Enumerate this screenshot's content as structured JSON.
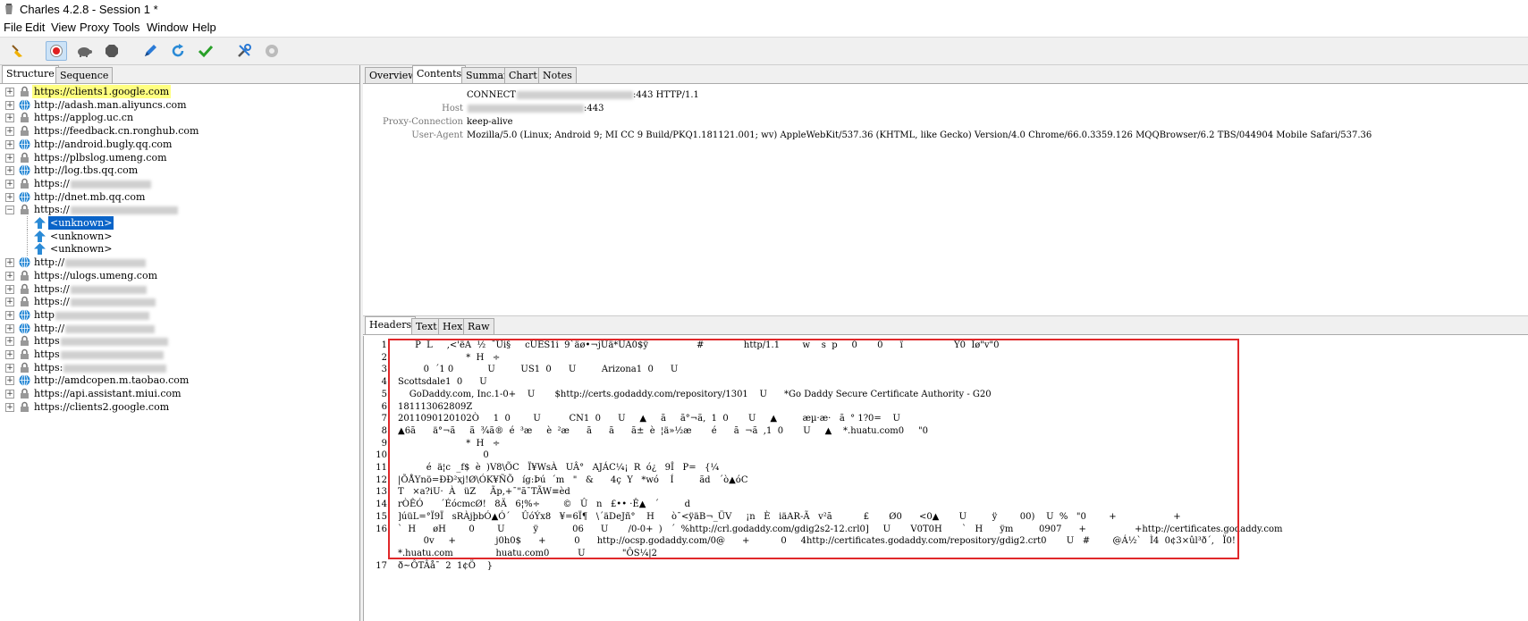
{
  "window": {
    "title": "Charles 4.2.8 - Session 1 *"
  },
  "menu": [
    "File",
    "Edit",
    "View",
    "Proxy",
    "Tools",
    "Window",
    "Help"
  ],
  "toolbar": {
    "icons": [
      "broom-icon",
      "record-icon",
      "turtle-icon",
      "hexagon-stop-icon",
      "pen-icon",
      "refresh-icon",
      "check-icon",
      "tools-icon",
      "gear-icon"
    ]
  },
  "left_tabs": [
    "Structure",
    "Sequence"
  ],
  "tree": [
    {
      "label": "https://clients1.google.com",
      "icon": "lock-icon",
      "state": "collapsed",
      "highlight": true
    },
    {
      "label": "http://adash.man.aliyuncs.com",
      "icon": "globe-icon",
      "state": "collapsed"
    },
    {
      "label": "https://applog.uc.cn",
      "icon": "lock-icon",
      "state": "collapsed"
    },
    {
      "label": "https://feedback.cn.ronghub.com",
      "icon": "lock-icon",
      "state": "collapsed"
    },
    {
      "label": "http://android.bugly.qq.com",
      "icon": "globe-icon",
      "state": "collapsed"
    },
    {
      "label": "https://plbslog.umeng.com",
      "icon": "lock-icon",
      "state": "collapsed"
    },
    {
      "label": "http://log.tbs.qq.com",
      "icon": "globe-icon",
      "state": "collapsed"
    },
    {
      "label": "https://",
      "icon": "lock-icon",
      "state": "collapsed",
      "redacted": 90
    },
    {
      "label": "http://dnet.mb.qq.com",
      "icon": "globe-icon",
      "state": "collapsed"
    },
    {
      "label": "https://",
      "icon": "lock-icon",
      "state": "expanded",
      "redacted": 120
    },
    {
      "label": "<unknown>",
      "icon": "upload-arrow-icon",
      "child": true,
      "selected": true
    },
    {
      "label": "<unknown>",
      "icon": "upload-arrow-icon",
      "child": true
    },
    {
      "label": "<unknown>",
      "icon": "upload-arrow-icon",
      "child": true
    },
    {
      "label": "http://",
      "icon": "globe-icon",
      "state": "collapsed",
      "redacted": 90
    },
    {
      "label": "https://ulogs.umeng.com",
      "icon": "lock-icon",
      "state": "collapsed"
    },
    {
      "label": "https://",
      "icon": "lock-icon",
      "state": "collapsed",
      "redacted": 85
    },
    {
      "label": "https://",
      "icon": "lock-icon",
      "state": "collapsed",
      "redacted": 95
    },
    {
      "label": "http",
      "icon": "globe-icon",
      "state": "collapsed",
      "redacted": 105
    },
    {
      "label": "http://",
      "icon": "globe-icon",
      "state": "collapsed",
      "redacted": 100
    },
    {
      "label": "https",
      "icon": "lock-icon",
      "state": "collapsed",
      "redacted": 120
    },
    {
      "label": "https",
      "icon": "lock-icon",
      "state": "collapsed",
      "redacted": 115
    },
    {
      "label": "https:",
      "icon": "lock-icon",
      "state": "collapsed",
      "redacted": 115
    },
    {
      "label": "http://amdcopen.m.taobao.com",
      "icon": "globe-icon",
      "state": "collapsed"
    },
    {
      "label": "https://api.assistant.miui.com",
      "icon": "lock-icon",
      "state": "collapsed"
    },
    {
      "label": "https://clients2.google.com",
      "icon": "lock-icon",
      "state": "collapsed"
    }
  ],
  "right_tabs": [
    "Overview",
    "Contents",
    "Summary",
    "Chart",
    "Notes"
  ],
  "headers": [
    {
      "key": "",
      "value": "CONNECT",
      "tail": ":443 HTTP/1.1",
      "redacted": 130
    },
    {
      "key": "Host",
      "value": "",
      "tail": ":443",
      "redacted": 130
    },
    {
      "key": "Proxy-Connection",
      "value": "keep-alive"
    },
    {
      "key": "User-Agent",
      "value": "Mozilla/5.0 (Linux; Android 9; MI CC 9 Build/PKQ1.181121.001; wv) AppleWebKit/537.36 (KHTML, like Gecko) Version/4.0 Chrome/66.0.3359.126 MQQBrowser/6.2 TBS/044904 Mobile Safari/537.36"
    }
  ],
  "bottom_tabs": [
    "Headers",
    "Text",
    "Hex",
    "Raw"
  ],
  "raw_lines": [
    {
      "n": "1",
      "text": "      P  L     ,<'ëÂ  ½  ¯Ûi§     cÜÊS1i  9`äø•¬jÜä*UÂ0$ÿ                 #              http/1.1        w    s  p     0       0      ï                  Ý0  Ïø\"v\"0"
    },
    {
      "n": "2",
      "text": "                        *  H   ÷"
    },
    {
      "n": "3",
      "text": "         0  ´1 0            U         US1  0      U         Arizona1  0      U"
    },
    {
      "n": "4",
      "text": "Scottsdale1  0      U"
    },
    {
      "n": "5",
      "text": "    GoDaddy.com, Inc.1-0+    U       $http://certs.godaddy.com/repository/1301    U      *Go Daddy Secure Certificate Authority - G20"
    },
    {
      "n": "6",
      "text": "181113062809Z"
    },
    {
      "n": "7",
      "text": "2011090120102Ò     1  0        U          CN1  0      U     ▲     ã     ã°¬ã,  1  0       U     ▲         æµ·æ·   ã  ° 1?0=    U"
    },
    {
      "n": "8",
      "text": "▲6ã      ä°¬ã     ã  ¾ã®  é  ³æ     è  ²æ      ã      ã      ã±  è  ¦ä»½æ       é      ã  ¬ã  ,1  0       U     ▲    *.huatu.com0     \"0"
    },
    {
      "n": "9",
      "text": "                        *  H   ÷"
    },
    {
      "n": "10",
      "text": "                              0"
    },
    {
      "n": "11",
      "text": "          é  ä¦c  _f$  è  )V8\\ÕC   Ï¥WsÀ   UÂ°   AJÁC¼¡  R  ó¿   9Î   P=   {¼"
    },
    {
      "n": "12",
      "text": "|ÕÅYnö=ÐÐ²xj!Ø\\ÓK¥ÑÕ   íg:Þú  ´m   \"   &      4ç  Y   *wó    Í         ãd   ´ò▲óC"
    },
    {
      "n": "13",
      "text": "T   ×a?iU·  À   üZ     Ãp,+¯\"ã¯TÃW≡èd"
    },
    {
      "n": "14",
      "text": "rÒÊÓ      ´ÉócmcØ!   8Ä   6¦%÷        ©   Û   n   £•• ·Ê▲   ´         d"
    },
    {
      "n": "15",
      "text": "]úüL=°Ï9Ï   sRÀjþbÓ▲Ó´    ÛóÝx8   ¥=6Ï¶   \\´äDeJñ°    H      ò¯<ÿäB¬_ÜV     ¡n   È   iäAR-Ã   v²ã           £       Ø0      <0▲       U         ÿ        00)    U  %   \"0        +                    +"
    },
    {
      "n": "16",
      "text": "`  H      øH        0        U          ÿ            06      U       /0-0+  )   ´  %http://crl.godaddy.com/gdig2s2-12.crl0]     U       V0T0H       `   H      ÿm         0907      +                 +http://certificates.godaddy.com"
    },
    {
      "n": "",
      "text": "         0v     +              j0h0$      +          0      http://ocsp.godaddy.com/0@      +           0     4http://certificates.godaddy.com/repository/gdig2.crt0       U   #        @Á½`   Ì4  0¢3×ûl³ð´,   Ï0!"
    },
    {
      "n": "",
      "text": "*.huatu.com               huatu.com0          U             \"ÔS¼|2"
    },
    {
      "n": "17",
      "text": "ð~ÔTÂå¯  2  1¢Ö    }"
    }
  ]
}
